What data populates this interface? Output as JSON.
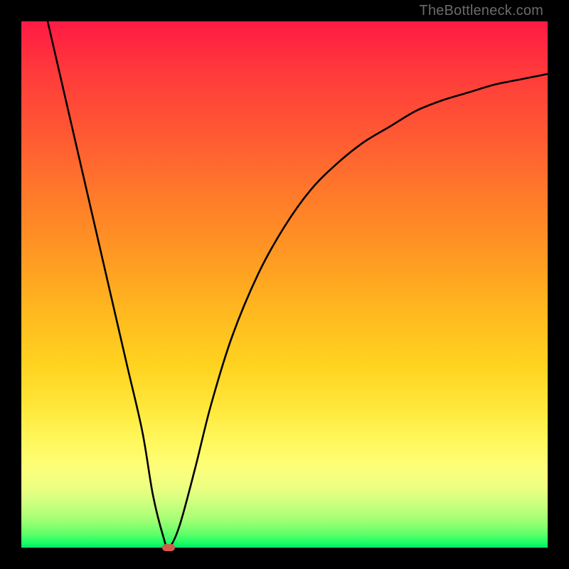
{
  "watermark": "TheBottleneck.com",
  "chart_data": {
    "type": "line",
    "title": "",
    "xlabel": "",
    "ylabel": "",
    "xlim": [
      0,
      100
    ],
    "ylim": [
      0,
      100
    ],
    "grid": false,
    "axes_visible": false,
    "background": "vertical-gradient red→orange→yellow→green",
    "series": [
      {
        "name": "bottleneck-curve",
        "color": "#000000",
        "x": [
          5,
          8,
          11,
          14,
          17,
          20,
          23,
          25,
          27,
          28,
          30,
          33,
          36,
          40,
          45,
          50,
          55,
          60,
          65,
          70,
          75,
          80,
          85,
          90,
          95,
          100
        ],
        "y": [
          100,
          87,
          74,
          61,
          48,
          35,
          22,
          10,
          2,
          0,
          4,
          15,
          27,
          40,
          52,
          61,
          68,
          73,
          77,
          80,
          83,
          85,
          86.5,
          88,
          89,
          90
        ]
      }
    ],
    "marker": {
      "name": "minimum-point",
      "x": 28,
      "y": 0,
      "color": "#d65a4a",
      "shape": "rounded-rect"
    }
  }
}
